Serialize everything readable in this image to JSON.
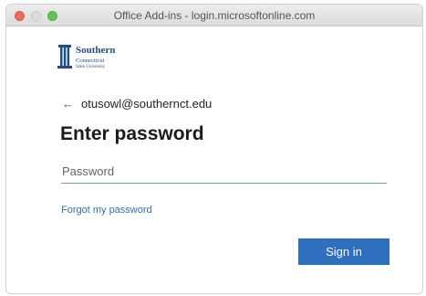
{
  "window": {
    "title": "Office Add-ins - login.microsoftonline.com"
  },
  "logo": {
    "line1": "Southern",
    "line2": "Connecticut",
    "line3": "State University"
  },
  "account": {
    "back_icon": "back-arrow-icon",
    "email": "otusowl@southernct.edu"
  },
  "form": {
    "heading": "Enter password",
    "password_placeholder": "Password",
    "password_value": "",
    "forgot_label": "Forgot my password",
    "signin_label": "Sign in"
  },
  "colors": {
    "accent": "#2f6fbf",
    "link": "#2f6eb5",
    "logo": "#1f4e87"
  }
}
